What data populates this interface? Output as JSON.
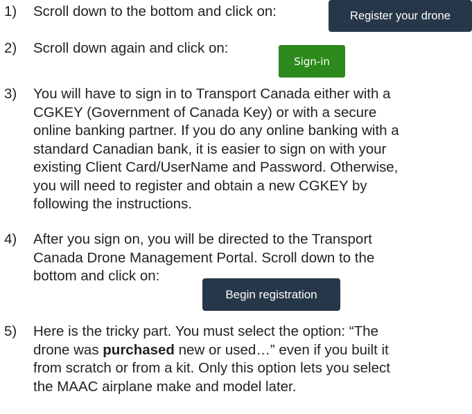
{
  "steps": [
    {
      "number": "1)",
      "lines": [
        "Scroll down to the bottom and click on:"
      ]
    },
    {
      "number": "2)",
      "lines": [
        "Scroll down again and click on:"
      ]
    },
    {
      "number": "3)",
      "lines": [
        "You will have to sign in to Transport Canada either with a",
        "CGKEY (Government of Canada Key) or with a secure",
        "online banking partner. If you do any online banking with a",
        "standard Canadian bank, it is easier to sign on with your",
        "existing Client Card/UserName and Password. Otherwise,",
        "you will need to register and obtain a new CGKEY by",
        "following the instructions."
      ]
    },
    {
      "number": "4)",
      "lines": [
        "After you sign on, you will be directed to the Transport",
        "Canada Drone Management Portal. Scroll down to the",
        "bottom and click on:"
      ]
    },
    {
      "number": "5)",
      "lines": [
        "Here is the tricky part. You must select the option: “The",
        "drone was ",
        "purchased",
        " new or used…” even if you built it",
        "from scratch or from a kit. Only this option lets you select",
        "the MAAC airplane make and model later."
      ]
    }
  ],
  "buttons": {
    "register_drone": "Register your drone",
    "sign_in": "Sign-in",
    "begin_registration": "Begin registration"
  },
  "colors": {
    "dark_button": "#263749",
    "green_button": "#2b8a1b",
    "text": "#222222"
  }
}
